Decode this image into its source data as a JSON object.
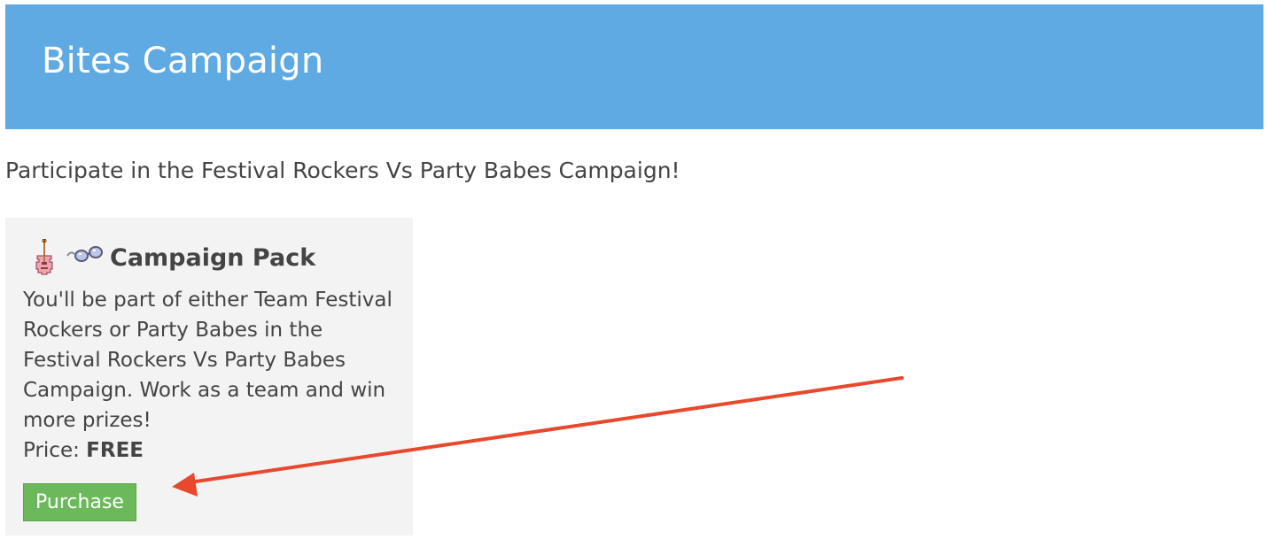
{
  "header": {
    "title": "Bites Campaign",
    "background_color": "#5faae3"
  },
  "intro": {
    "text": "Participate in the Festival Rockers Vs Party Babes Campaign!"
  },
  "pack": {
    "icons": [
      "guitar-icon",
      "glasses-icon"
    ],
    "title": "Campaign Pack",
    "description": "You'll be part of either Team Festival Rockers or Party Babes in the Festival Rockers Vs Party Babes Campaign. Work as a team and win more prizes!",
    "price_label": "Price:",
    "price_value": "FREE",
    "purchase_label": "Purchase",
    "button_color": "#6cb95c"
  },
  "annotation": {
    "arrow_color": "#e8482c"
  }
}
